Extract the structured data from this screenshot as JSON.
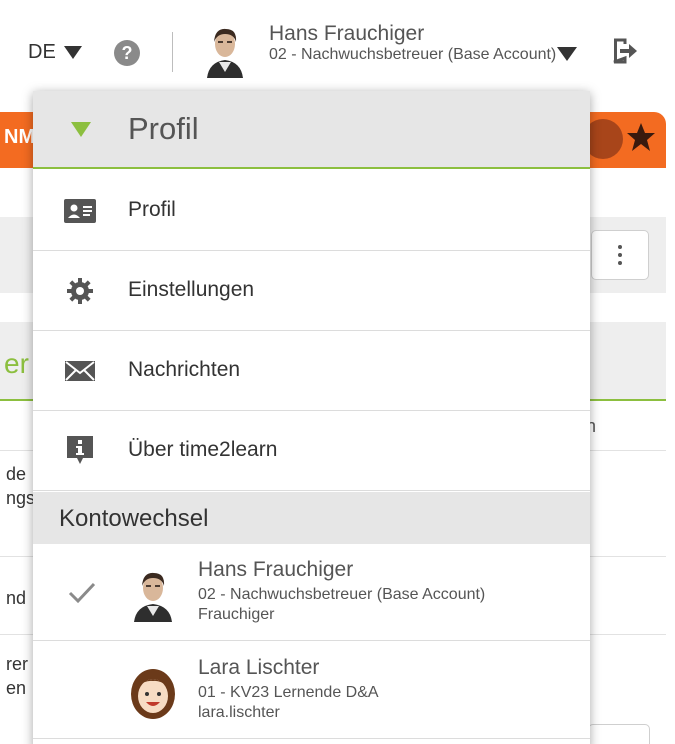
{
  "header": {
    "language": "DE",
    "help_symbol": "?",
    "user": {
      "name": "Hans Frauchiger",
      "role": "02 - Nachwuchsbetreuer (Base Account)"
    },
    "icons": [
      "chevron-down-icon",
      "help-icon",
      "avatar",
      "logout-icon"
    ]
  },
  "background": {
    "orange_fragment": "NM",
    "green_fragment": "er",
    "column_fragment": "n",
    "rows": [
      {
        "line1": "de",
        "line2": "ngs"
      },
      {
        "line1": "nd",
        "line2": ""
      },
      {
        "line1": "rer",
        "line2": "en"
      }
    ],
    "icons": [
      "star-icon",
      "kebab-menu-icon"
    ]
  },
  "dropdown": {
    "title": "Profil",
    "items": [
      {
        "label": "Profil",
        "icon": "id-card-icon"
      },
      {
        "label": "Einstellungen",
        "icon": "gear-icon"
      },
      {
        "label": "Nachrichten",
        "icon": "envelope-icon"
      },
      {
        "label": "Über time2learn",
        "icon": "info-icon"
      }
    ],
    "account_switch": {
      "title": "Kontowechsel",
      "accounts": [
        {
          "name": "Hans Frauchiger",
          "role": "02 - Nachwuchsbetreuer (Base Account)",
          "username": "Frauchiger",
          "active": true
        },
        {
          "name": "Lara Lischter",
          "role": "01 - KV23 Lernende D&A",
          "username": "lara.lischter",
          "active": false
        }
      ]
    }
  },
  "colors": {
    "accent_green": "#8cbf3f",
    "accent_orange": "#f36b21",
    "header_gray": "#e6e6e6"
  }
}
